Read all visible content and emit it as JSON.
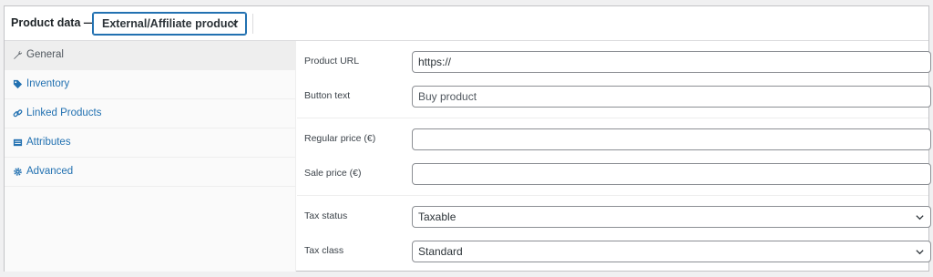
{
  "header": {
    "title": "Product data —",
    "product_type": "External/Affiliate product"
  },
  "sidebar": {
    "items": [
      {
        "label": "General",
        "icon": "wrench-icon"
      },
      {
        "label": "Inventory",
        "icon": "tag-icon"
      },
      {
        "label": "Linked Products",
        "icon": "link-icon"
      },
      {
        "label": "Attributes",
        "icon": "list-icon"
      },
      {
        "label": "Advanced",
        "icon": "gear-icon"
      }
    ]
  },
  "fields": {
    "product_url": {
      "label": "Product URL",
      "value": "https://"
    },
    "button_text": {
      "label": "Button text",
      "placeholder": "Buy product"
    },
    "regular_price": {
      "label": "Regular price (€)",
      "value": ""
    },
    "sale_price": {
      "label": "Sale price (€)",
      "value": ""
    },
    "tax_status": {
      "label": "Tax status",
      "value": "Taxable"
    },
    "tax_class": {
      "label": "Tax class",
      "value": "Standard"
    }
  },
  "colors": {
    "accent": "#2271b1",
    "border": "#8c8f94",
    "panel_border": "#c3c4c7"
  }
}
